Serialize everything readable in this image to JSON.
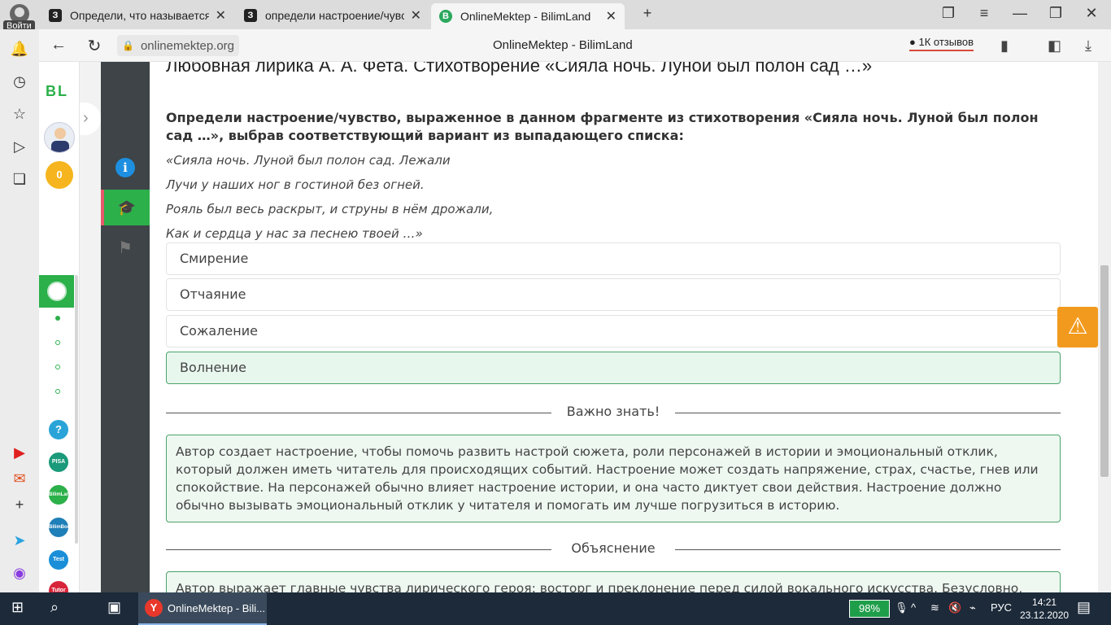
{
  "browser": {
    "profile_label": "Войти",
    "tabs": [
      {
        "icon": "З",
        "title": "Определи, что называется т",
        "active": false
      },
      {
        "icon": "З",
        "title": "определи настроение/чувст",
        "active": false
      },
      {
        "icon": "B",
        "title": "OnlineMektep - BilimLand",
        "active": true
      }
    ],
    "url": "onlinemektep.org",
    "page_title": "OnlineMektep - BilimLand",
    "reviews_label": "1К отзывов"
  },
  "rail": {
    "logo": "BL",
    "coins": "0",
    "apps": [
      "?",
      "PISA",
      "BilimLand",
      "BilimBook",
      "Test",
      "Tutor"
    ]
  },
  "content": {
    "lesson_title": "Любовная лирика А. А. Фета. Стихотворение «Сияла ночь. Луной был полон сад …»",
    "question": "Определи настроение/чувство, выраженное в данном фрагменте из стихотворения «Сияла ночь. Луной был полон сад …», выбрав соответствующий вариант из выпадающего списка:",
    "poem": [
      "«Сияла ночь. Луной был полон сад. Лежали",
      "Лучи у наших ног в гостиной без огней.",
      "Рояль был весь раскрыт, и струны в нём дрожали,",
      "Как и  сердца у нас за песнею твоей …»"
    ],
    "options": [
      "Смирение",
      "Отчаяние",
      "Сожаление",
      "Волнение"
    ],
    "selected_option": "Волнение",
    "important_label": "Важно знать!",
    "important_text": "Автор создает настроение, чтобы помочь развить настрой сюжета, роли персонажей в истории и эмоциональный отклик, который должен иметь читатель для происходящих событий. Настроение может создать напряжение, страх, счастье, гнев или спокойствие. На персонажей обычно влияет настроение истории, и она часто диктует свои действия. Настроение должно обычно вызывать эмоциональный отклик у читателя и помогать им лучше погрузиться в историю.",
    "explanation_label": "Объяснение",
    "explanation_text": "Автор выражает главные чувства лирического героя: восторг и преклонение перед силой вокального искусства. Безусловно,"
  },
  "taskbar": {
    "active_task": "OnlineMektep - Bili...",
    "battery": "98%",
    "language": "РУС",
    "time": "14:21",
    "date": "23.12.2020"
  },
  "colors": {
    "accent_green": "#2bb04a",
    "sidebar_dark": "#3e4447",
    "warning_orange": "#f29a1d",
    "selected_bg": "#e8f7ee"
  }
}
